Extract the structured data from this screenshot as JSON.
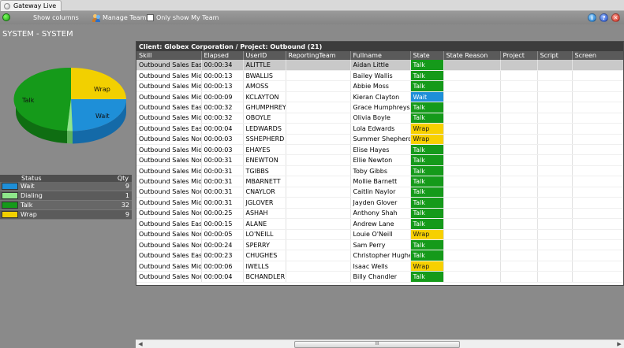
{
  "window": {
    "title": "Gateway Live"
  },
  "toolbar": {
    "status_icon": "green-status-dot",
    "show_columns": "Show columns",
    "manage_team": "Manage Team",
    "only_my_team": "Only show My Team",
    "only_my_team_checked": false
  },
  "left": {
    "title": "SYSTEM - SYSTEM",
    "pie_labels": {
      "wrap": "Wrap",
      "talk": "Talk",
      "wait": "Wait"
    },
    "legend": {
      "header_status": "Status",
      "header_qty": "Qty",
      "items": [
        {
          "label": "Wait",
          "qty": "9",
          "color": "#1e8fd8"
        },
        {
          "label": "Dialing",
          "qty": "1",
          "color": "#8ee68a"
        },
        {
          "label": "Talk",
          "qty": "32",
          "color": "#159a1a"
        },
        {
          "label": "Wrap",
          "qty": "9",
          "color": "#f2d000"
        }
      ]
    }
  },
  "grid": {
    "title": "Client: Globex Corporation / Project: Outbound (21)",
    "columns": [
      "Skill",
      "Elapsed",
      "UserID",
      "ReportingTeam",
      "Fullname",
      "State",
      "State Reason",
      "Project",
      "Script",
      "Screen"
    ],
    "rows": [
      [
        "Outbound Sales East",
        "00:00:34",
        "ALITTLE",
        "",
        "Aidan Little",
        "Talk"
      ],
      [
        "Outbound Sales Midlands",
        "00:00:13",
        "BWALLIS",
        "",
        "Bailey Wallis",
        "Talk"
      ],
      [
        "Outbound Sales Midlands",
        "00:00:13",
        "AMOSS",
        "",
        "Abbie Moss",
        "Talk"
      ],
      [
        "Outbound Sales Midlands",
        "00:00:09",
        "KCLAYTON",
        "",
        "Kieran Clayton",
        "Wait"
      ],
      [
        "Outbound Sales East",
        "00:00:32",
        "GHUMPHREYS",
        "",
        "Grace Humphreys",
        "Talk"
      ],
      [
        "Outbound Sales Midlands",
        "00:00:32",
        "OBOYLE",
        "",
        "Olivia Boyle",
        "Talk"
      ],
      [
        "Outbound Sales East",
        "00:00:04",
        "LEDWARDS",
        "",
        "Lola Edwards",
        "Wrap"
      ],
      [
        "Outbound Sales North",
        "00:00:03",
        "SSHEPHERD",
        "",
        "Summer Shepherd",
        "Wrap"
      ],
      [
        "Outbound Sales Midlands",
        "00:00:03",
        "EHAYES",
        "",
        "Elise Hayes",
        "Talk"
      ],
      [
        "Outbound Sales North",
        "00:00:31",
        "ENEWTON",
        "",
        "Ellie Newton",
        "Talk"
      ],
      [
        "Outbound Sales Midlands",
        "00:00:31",
        "TGIBBS",
        "",
        "Toby Gibbs",
        "Talk"
      ],
      [
        "Outbound Sales Midlands",
        "00:00:31",
        "MBARNETT",
        "",
        "Mollie Barnett",
        "Talk"
      ],
      [
        "Outbound Sales North",
        "00:00:31",
        "CNAYLOR",
        "",
        "Caitlin Naylor",
        "Talk"
      ],
      [
        "Outbound Sales Midlands",
        "00:00:31",
        "JGLOVER",
        "",
        "Jayden Glover",
        "Talk"
      ],
      [
        "Outbound Sales North",
        "00:00:25",
        "ASHAH",
        "",
        "Anthony Shah",
        "Talk"
      ],
      [
        "Outbound Sales East",
        "00:00:15",
        "ALANE",
        "",
        "Andrew Lane",
        "Talk"
      ],
      [
        "Outbound Sales North",
        "00:00:05",
        "LO'NEILL",
        "",
        "Louie O'Neill",
        "Wrap"
      ],
      [
        "Outbound Sales North",
        "00:00:24",
        "SPERRY",
        "",
        "Sam Perry",
        "Talk"
      ],
      [
        "Outbound Sales East",
        "00:00:23",
        "CHUGHES",
        "",
        "Christopher Hughes",
        "Talk"
      ],
      [
        "Outbound Sales Midlands",
        "00:00:06",
        "IWELLS",
        "",
        "Isaac Wells",
        "Wrap"
      ],
      [
        "Outbound Sales North",
        "00:00:04",
        "BCHANDLER",
        "",
        "Billy Chandler",
        "Talk"
      ]
    ],
    "selected_row": 0,
    "state_colors": {
      "Talk": "#159a1a",
      "Wait": "#1e8fd8",
      "Wrap": "#f7d000"
    },
    "state_text_colors": {
      "Talk": "#ffffff",
      "Wait": "#ffffff",
      "Wrap": "#1a1a1a"
    }
  },
  "scrollbar": {
    "thumb_glyph": "III",
    "left_glyph": "◀",
    "right_glyph": "▶"
  }
}
